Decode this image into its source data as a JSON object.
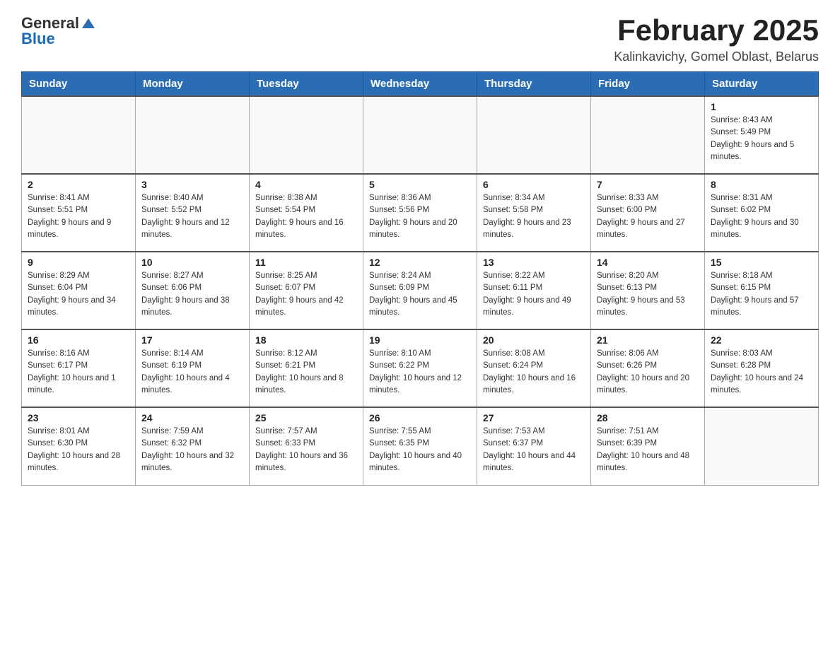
{
  "header": {
    "logo_general": "General",
    "logo_blue": "Blue",
    "month_title": "February 2025",
    "location": "Kalinkavichy, Gomel Oblast, Belarus"
  },
  "weekdays": [
    "Sunday",
    "Monday",
    "Tuesday",
    "Wednesday",
    "Thursday",
    "Friday",
    "Saturday"
  ],
  "weeks": [
    {
      "days": [
        {
          "number": "",
          "info": ""
        },
        {
          "number": "",
          "info": ""
        },
        {
          "number": "",
          "info": ""
        },
        {
          "number": "",
          "info": ""
        },
        {
          "number": "",
          "info": ""
        },
        {
          "number": "",
          "info": ""
        },
        {
          "number": "1",
          "info": "Sunrise: 8:43 AM\nSunset: 5:49 PM\nDaylight: 9 hours and 5 minutes."
        }
      ]
    },
    {
      "days": [
        {
          "number": "2",
          "info": "Sunrise: 8:41 AM\nSunset: 5:51 PM\nDaylight: 9 hours and 9 minutes."
        },
        {
          "number": "3",
          "info": "Sunrise: 8:40 AM\nSunset: 5:52 PM\nDaylight: 9 hours and 12 minutes."
        },
        {
          "number": "4",
          "info": "Sunrise: 8:38 AM\nSunset: 5:54 PM\nDaylight: 9 hours and 16 minutes."
        },
        {
          "number": "5",
          "info": "Sunrise: 8:36 AM\nSunset: 5:56 PM\nDaylight: 9 hours and 20 minutes."
        },
        {
          "number": "6",
          "info": "Sunrise: 8:34 AM\nSunset: 5:58 PM\nDaylight: 9 hours and 23 minutes."
        },
        {
          "number": "7",
          "info": "Sunrise: 8:33 AM\nSunset: 6:00 PM\nDaylight: 9 hours and 27 minutes."
        },
        {
          "number": "8",
          "info": "Sunrise: 8:31 AM\nSunset: 6:02 PM\nDaylight: 9 hours and 30 minutes."
        }
      ]
    },
    {
      "days": [
        {
          "number": "9",
          "info": "Sunrise: 8:29 AM\nSunset: 6:04 PM\nDaylight: 9 hours and 34 minutes."
        },
        {
          "number": "10",
          "info": "Sunrise: 8:27 AM\nSunset: 6:06 PM\nDaylight: 9 hours and 38 minutes."
        },
        {
          "number": "11",
          "info": "Sunrise: 8:25 AM\nSunset: 6:07 PM\nDaylight: 9 hours and 42 minutes."
        },
        {
          "number": "12",
          "info": "Sunrise: 8:24 AM\nSunset: 6:09 PM\nDaylight: 9 hours and 45 minutes."
        },
        {
          "number": "13",
          "info": "Sunrise: 8:22 AM\nSunset: 6:11 PM\nDaylight: 9 hours and 49 minutes."
        },
        {
          "number": "14",
          "info": "Sunrise: 8:20 AM\nSunset: 6:13 PM\nDaylight: 9 hours and 53 minutes."
        },
        {
          "number": "15",
          "info": "Sunrise: 8:18 AM\nSunset: 6:15 PM\nDaylight: 9 hours and 57 minutes."
        }
      ]
    },
    {
      "days": [
        {
          "number": "16",
          "info": "Sunrise: 8:16 AM\nSunset: 6:17 PM\nDaylight: 10 hours and 1 minute."
        },
        {
          "number": "17",
          "info": "Sunrise: 8:14 AM\nSunset: 6:19 PM\nDaylight: 10 hours and 4 minutes."
        },
        {
          "number": "18",
          "info": "Sunrise: 8:12 AM\nSunset: 6:21 PM\nDaylight: 10 hours and 8 minutes."
        },
        {
          "number": "19",
          "info": "Sunrise: 8:10 AM\nSunset: 6:22 PM\nDaylight: 10 hours and 12 minutes."
        },
        {
          "number": "20",
          "info": "Sunrise: 8:08 AM\nSunset: 6:24 PM\nDaylight: 10 hours and 16 minutes."
        },
        {
          "number": "21",
          "info": "Sunrise: 8:06 AM\nSunset: 6:26 PM\nDaylight: 10 hours and 20 minutes."
        },
        {
          "number": "22",
          "info": "Sunrise: 8:03 AM\nSunset: 6:28 PM\nDaylight: 10 hours and 24 minutes."
        }
      ]
    },
    {
      "days": [
        {
          "number": "23",
          "info": "Sunrise: 8:01 AM\nSunset: 6:30 PM\nDaylight: 10 hours and 28 minutes."
        },
        {
          "number": "24",
          "info": "Sunrise: 7:59 AM\nSunset: 6:32 PM\nDaylight: 10 hours and 32 minutes."
        },
        {
          "number": "25",
          "info": "Sunrise: 7:57 AM\nSunset: 6:33 PM\nDaylight: 10 hours and 36 minutes."
        },
        {
          "number": "26",
          "info": "Sunrise: 7:55 AM\nSunset: 6:35 PM\nDaylight: 10 hours and 40 minutes."
        },
        {
          "number": "27",
          "info": "Sunrise: 7:53 AM\nSunset: 6:37 PM\nDaylight: 10 hours and 44 minutes."
        },
        {
          "number": "28",
          "info": "Sunrise: 7:51 AM\nSunset: 6:39 PM\nDaylight: 10 hours and 48 minutes."
        },
        {
          "number": "",
          "info": ""
        }
      ]
    }
  ]
}
